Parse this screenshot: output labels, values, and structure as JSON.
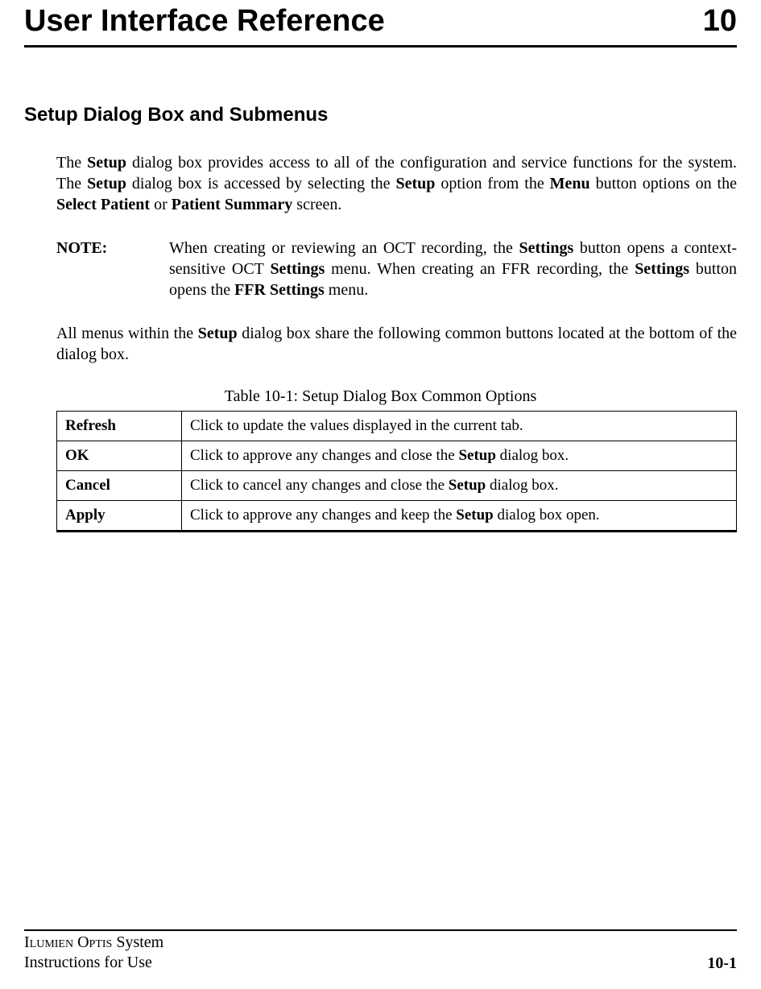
{
  "chapter": {
    "title": "User Interface Reference",
    "number": "10"
  },
  "section": {
    "heading": "Setup Dialog Box and Submenus"
  },
  "paragraphs": {
    "p1_part1": "The ",
    "p1_bold1": "Setup",
    "p1_part2": " dialog box provides access to all of the configuration and service functions for the system. The ",
    "p1_bold2": "Setup",
    "p1_part3": " dialog box is accessed by selecting the ",
    "p1_bold3": "Setup",
    "p1_part4": " option from the ",
    "p1_bold4": "Menu",
    "p1_part5": " button options on the ",
    "p1_bold5": "Select Patient",
    "p1_part6": " or ",
    "p1_bold6": "Patient Summary",
    "p1_part7": " screen.",
    "note_label": "NOTE:",
    "note_part1": "When creating or reviewing an OCT recording, the ",
    "note_bold1": "Settings",
    "note_part2": " button opens a context-sensitive OCT ",
    "note_bold2": "Settings",
    "note_part3": " menu. When creating an FFR recording, the ",
    "note_bold3": "Settings",
    "note_part4": " button opens the ",
    "note_bold4": "FFR Settings",
    "note_part5": " menu.",
    "p2_part1": "All menus within the ",
    "p2_bold1": "Setup",
    "p2_part2": " dialog box share the following common buttons located at the bottom of the dialog box."
  },
  "table": {
    "caption": "Table 10-1:  Setup Dialog Box Common Options",
    "rows": [
      {
        "label": "Refresh",
        "desc_part1": "Click to update the values displayed in the current tab.",
        "desc_bold": "",
        "desc_part2": ""
      },
      {
        "label": "OK",
        "desc_part1": "Click to approve any changes and close the ",
        "desc_bold": "Setup",
        "desc_part2": " dialog box."
      },
      {
        "label": "Cancel",
        "desc_part1": "Click to cancel any changes and close the ",
        "desc_bold": "Setup",
        "desc_part2": " dialog box."
      },
      {
        "label": "Apply",
        "desc_part1": "Click to approve any changes and keep the ",
        "desc_bold": "Setup",
        "desc_part2": " dialog box open."
      }
    ]
  },
  "footer": {
    "line1_sc1": "Ilumien",
    "line1_sc2": " Optis",
    "line1_rest": " System",
    "line2": "Instructions for Use",
    "page": "10-1"
  }
}
